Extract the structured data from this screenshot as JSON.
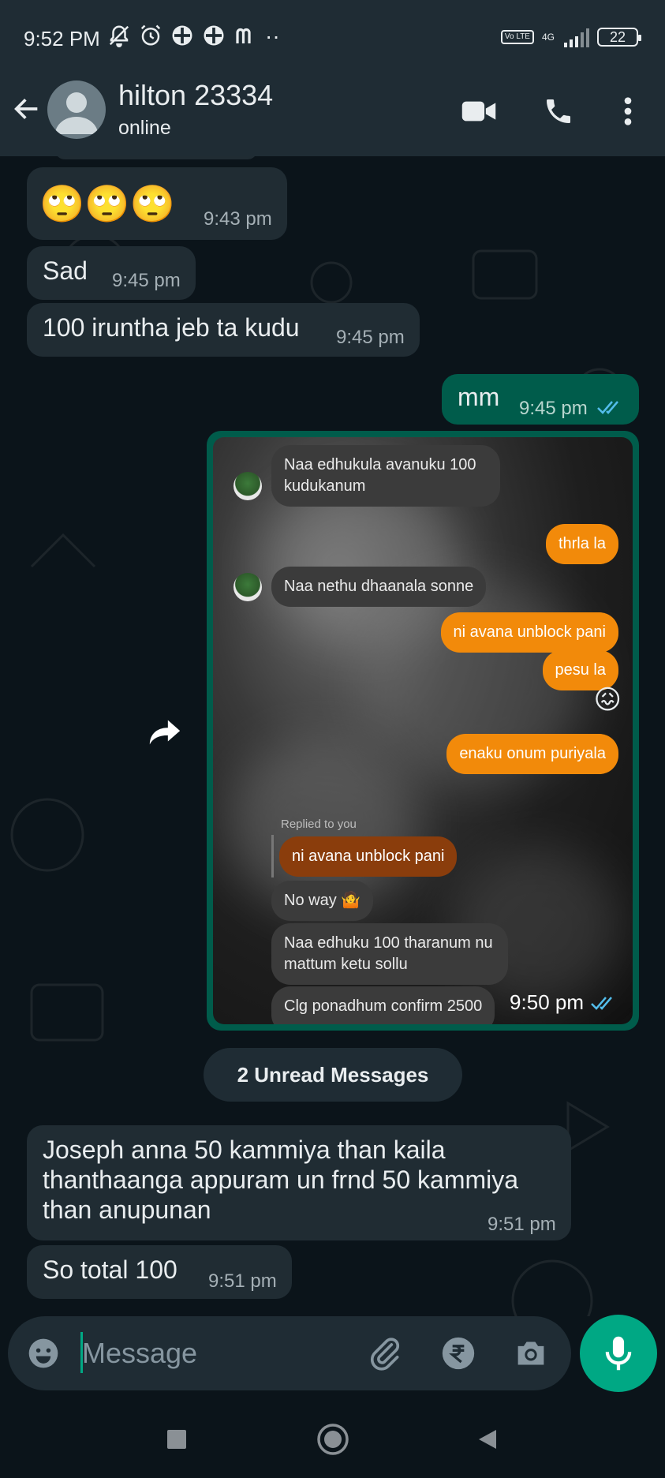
{
  "status_bar": {
    "time": "9:52 PM",
    "notif_icons": [
      "mute-bell-icon",
      "alarm-icon",
      "app-icon",
      "app-icon",
      "m-icon"
    ],
    "more_dots": "··",
    "volte": "Vo LTE",
    "network": "4G",
    "battery": "22"
  },
  "header": {
    "name": "hilton 23334",
    "status": "online"
  },
  "messages": [
    {
      "dir": "in",
      "text": "🙄🙄🙄",
      "time": "9:43 pm"
    },
    {
      "dir": "in",
      "text": "Sad",
      "time": "9:45 pm"
    },
    {
      "dir": "in",
      "text": "100 iruntha jeb ta kudu",
      "time": "9:45 pm"
    },
    {
      "dir": "out",
      "text": "mm",
      "time": "9:45 pm"
    },
    {
      "dir": "in",
      "text": "Joseph anna 50 kammiya than kaila thanthaanga appuram un frnd 50 kammiya than anupunan",
      "time": "9:51 pm"
    },
    {
      "dir": "in",
      "text": "So total 100",
      "time": "9:51 pm"
    }
  ],
  "media_message": {
    "time": "9:50 pm",
    "screenshot": {
      "msg1": "Naa edhukula avanuku 100 kudukanum",
      "msg2": "thrla la",
      "msg3": "Naa nethu dhaanala sonne",
      "msg4": "ni avana unblock pani",
      "msg5": "pesu la",
      "msg6": "😖",
      "msg7": "enaku onum puriyala",
      "replied_label": "Replied to you",
      "quoted": "ni avana unblock pani",
      "msg8": "No way 🤷",
      "msg9": "Naa edhuku 100 tharanum nu mattum ketu sollu",
      "msg10": "Clg ponadhum confirm 2500"
    }
  },
  "unread_banner": "2 Unread Messages",
  "input": {
    "placeholder": "Message"
  },
  "colors": {
    "header_bg": "#1f2c34",
    "incoming_bubble": "#202c33",
    "outgoing_bubble": "#005c4b",
    "accent": "#00a884",
    "read_ticks": "#53bdeb",
    "orange": "#f28a0a"
  }
}
